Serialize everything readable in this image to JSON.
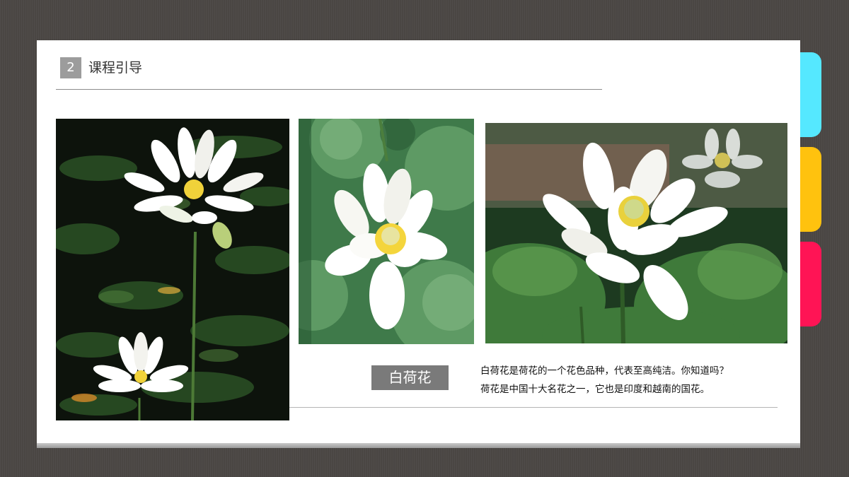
{
  "section": {
    "number": "2",
    "title": "课程引导"
  },
  "flower": {
    "name": "白荷花"
  },
  "description": {
    "line1": "白荷花是荷花的一个花色品种，代表至高纯洁。你知道吗？",
    "line2": "荷花是中国十大名花之一，它也是印度和越南的国花。"
  },
  "colors": {
    "tab_cyan": "#55e8ff",
    "tab_yellow": "#ffc20e",
    "tab_red": "#ff1455",
    "label_bg": "#7a7a7a",
    "number_bg": "#9c9c9c"
  },
  "images": [
    "white-lotus-pond-photo",
    "white-lotus-closeup-photo",
    "white-lotus-leaves-photo"
  ]
}
